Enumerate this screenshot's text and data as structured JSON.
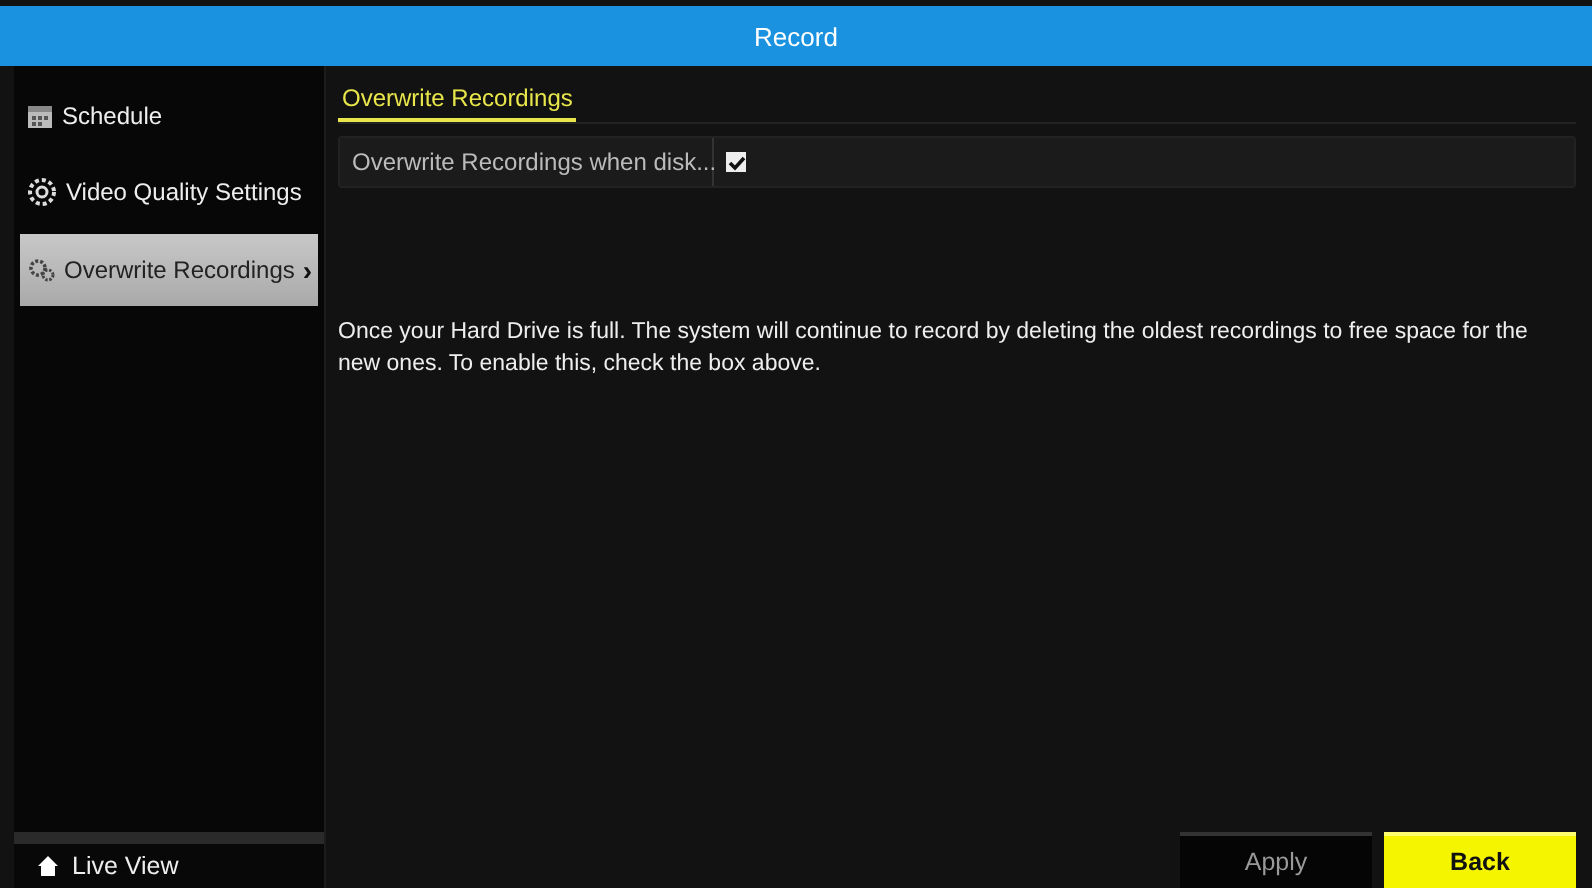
{
  "window": {
    "title": "Record"
  },
  "sidebar": {
    "items": [
      {
        "label": "Schedule",
        "selected": false
      },
      {
        "label": "Video Quality Settings",
        "selected": false
      },
      {
        "label": "Overwrite Recordings",
        "selected": true,
        "arrow": "›"
      }
    ],
    "footer": {
      "label": "Live View"
    }
  },
  "tabs": [
    {
      "label": "Overwrite Recordings",
      "selected": true
    }
  ],
  "settings": [
    {
      "label": "Overwrite Recordings when disk...",
      "checked": true
    }
  ],
  "description": "Once your Hard Drive is full. The system will continue to record by deleting the oldest recordings to free space for the new ones. To enable this, check the box above.",
  "buttons": [
    {
      "label": "Apply",
      "kind": "secondary"
    },
    {
      "label": "Back",
      "kind": "primary"
    }
  ]
}
